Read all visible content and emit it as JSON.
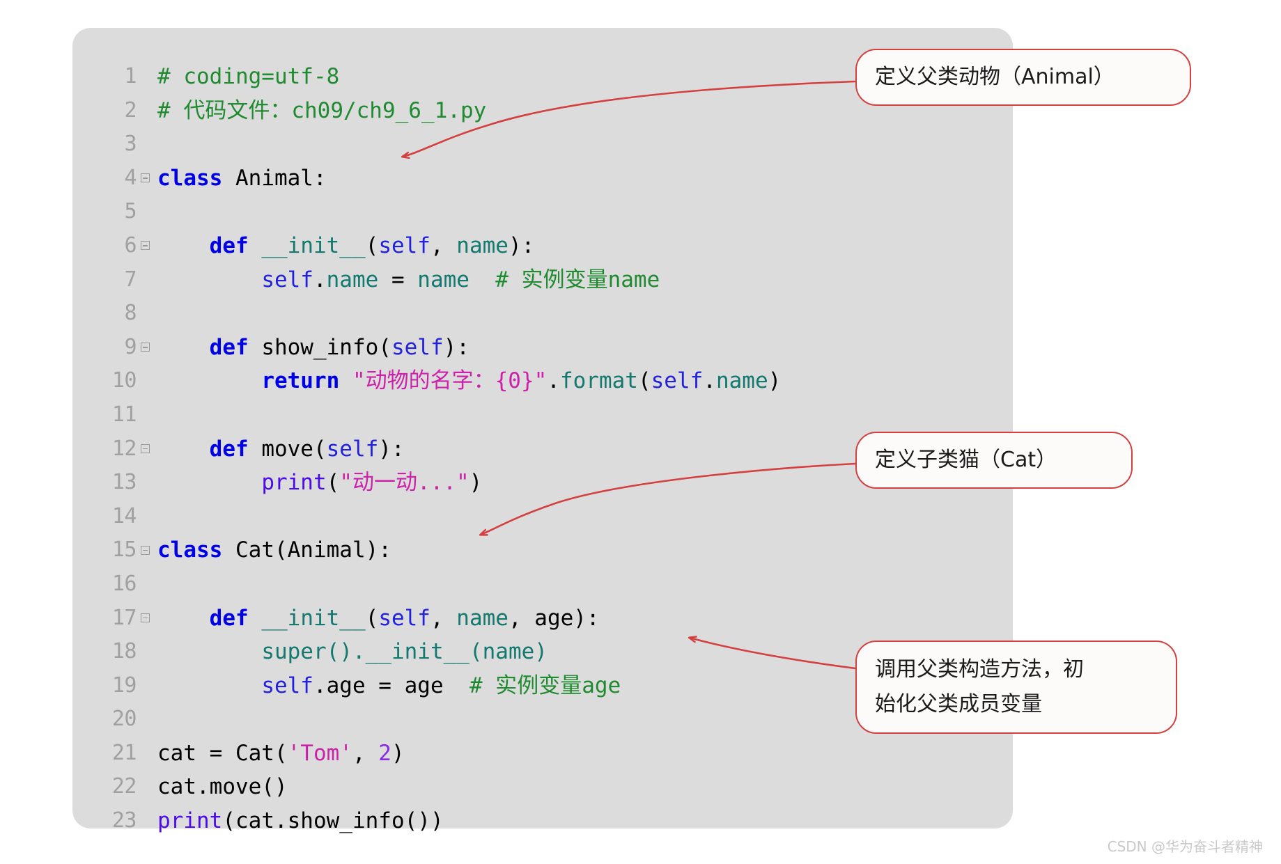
{
  "editor": {
    "panel_background": "#dcdcdc",
    "lines": [
      {
        "num": "1",
        "fold": false,
        "tokens": [
          {
            "t": "# coding=utf-8",
            "c": "cmt"
          }
        ]
      },
      {
        "num": "2",
        "fold": false,
        "tokens": [
          {
            "t": "# 代码文件：ch09/ch9_6_1.py",
            "c": "cmt"
          }
        ]
      },
      {
        "num": "3",
        "fold": false,
        "tokens": []
      },
      {
        "num": "4",
        "fold": true,
        "tokens": [
          {
            "t": "class",
            "c": "kw"
          },
          {
            "t": " Animal:",
            "c": "plain"
          }
        ]
      },
      {
        "num": "5",
        "fold": false,
        "tokens": []
      },
      {
        "num": "6",
        "fold": true,
        "tokens": [
          {
            "t": "    ",
            "c": "plain"
          },
          {
            "t": "def",
            "c": "kw"
          },
          {
            "t": " ",
            "c": "plain"
          },
          {
            "t": "__init__",
            "c": "teal"
          },
          {
            "t": "(",
            "c": "plain"
          },
          {
            "t": "self",
            "c": "self"
          },
          {
            "t": ", ",
            "c": "plain"
          },
          {
            "t": "name",
            "c": "teal"
          },
          {
            "t": "):",
            "c": "plain"
          }
        ]
      },
      {
        "num": "7",
        "fold": false,
        "tokens": [
          {
            "t": "        ",
            "c": "plain"
          },
          {
            "t": "self",
            "c": "self"
          },
          {
            "t": ".",
            "c": "plain"
          },
          {
            "t": "name",
            "c": "teal"
          },
          {
            "t": " = ",
            "c": "plain"
          },
          {
            "t": "name",
            "c": "teal"
          },
          {
            "t": "  ",
            "c": "plain"
          },
          {
            "t": "# 实例变量name",
            "c": "cmt"
          }
        ]
      },
      {
        "num": "8",
        "fold": false,
        "tokens": []
      },
      {
        "num": "9",
        "fold": true,
        "tokens": [
          {
            "t": "    ",
            "c": "plain"
          },
          {
            "t": "def",
            "c": "kw"
          },
          {
            "t": " show_info(",
            "c": "plain"
          },
          {
            "t": "self",
            "c": "self"
          },
          {
            "t": "):",
            "c": "plain"
          }
        ]
      },
      {
        "num": "10",
        "fold": false,
        "tokens": [
          {
            "t": "        ",
            "c": "plain"
          },
          {
            "t": "return",
            "c": "kw"
          },
          {
            "t": " ",
            "c": "plain"
          },
          {
            "t": "\"动物的名字：{0}\"",
            "c": "str"
          },
          {
            "t": ".",
            "c": "plain"
          },
          {
            "t": "format",
            "c": "teal"
          },
          {
            "t": "(",
            "c": "plain"
          },
          {
            "t": "self",
            "c": "self"
          },
          {
            "t": ".",
            "c": "plain"
          },
          {
            "t": "name",
            "c": "teal"
          },
          {
            "t": ")",
            "c": "plain"
          }
        ]
      },
      {
        "num": "11",
        "fold": false,
        "tokens": []
      },
      {
        "num": "12",
        "fold": true,
        "tokens": [
          {
            "t": "    ",
            "c": "plain"
          },
          {
            "t": "def",
            "c": "kw"
          },
          {
            "t": " move(",
            "c": "plain"
          },
          {
            "t": "self",
            "c": "self"
          },
          {
            "t": "):",
            "c": "plain"
          }
        ]
      },
      {
        "num": "13",
        "fold": false,
        "tokens": [
          {
            "t": "        ",
            "c": "plain"
          },
          {
            "t": "print",
            "c": "builtin"
          },
          {
            "t": "(",
            "c": "plain"
          },
          {
            "t": "\"动一动...\"",
            "c": "str"
          },
          {
            "t": ")",
            "c": "plain"
          }
        ]
      },
      {
        "num": "14",
        "fold": false,
        "tokens": []
      },
      {
        "num": "15",
        "fold": true,
        "tokens": [
          {
            "t": "class",
            "c": "kw"
          },
          {
            "t": " Cat(Animal):",
            "c": "plain"
          }
        ]
      },
      {
        "num": "16",
        "fold": false,
        "tokens": []
      },
      {
        "num": "17",
        "fold": true,
        "tokens": [
          {
            "t": "    ",
            "c": "plain"
          },
          {
            "t": "def",
            "c": "kw"
          },
          {
            "t": " ",
            "c": "plain"
          },
          {
            "t": "__init__",
            "c": "teal"
          },
          {
            "t": "(",
            "c": "plain"
          },
          {
            "t": "self",
            "c": "self"
          },
          {
            "t": ", ",
            "c": "plain"
          },
          {
            "t": "name",
            "c": "teal"
          },
          {
            "t": ", age):",
            "c": "plain"
          }
        ]
      },
      {
        "num": "18",
        "fold": false,
        "tokens": [
          {
            "t": "        ",
            "c": "plain"
          },
          {
            "t": "super",
            "c": "teal"
          },
          {
            "t": "().",
            "c": "teal"
          },
          {
            "t": "__init__",
            "c": "teal"
          },
          {
            "t": "(",
            "c": "teal"
          },
          {
            "t": "name",
            "c": "teal"
          },
          {
            "t": ")",
            "c": "teal"
          }
        ]
      },
      {
        "num": "19",
        "fold": false,
        "tokens": [
          {
            "t": "        ",
            "c": "plain"
          },
          {
            "t": "self",
            "c": "self"
          },
          {
            "t": ".age = age",
            "c": "plain"
          },
          {
            "t": "  ",
            "c": "plain"
          },
          {
            "t": "# 实例变量age",
            "c": "cmt"
          }
        ]
      },
      {
        "num": "20",
        "fold": false,
        "tokens": []
      },
      {
        "num": "21",
        "fold": false,
        "tokens": [
          {
            "t": "cat = Cat(",
            "c": "plain"
          },
          {
            "t": "'Tom'",
            "c": "str"
          },
          {
            "t": ", ",
            "c": "plain"
          },
          {
            "t": "2",
            "c": "num"
          },
          {
            "t": ")",
            "c": "plain"
          }
        ]
      },
      {
        "num": "22",
        "fold": false,
        "tokens": [
          {
            "t": "cat.move()",
            "c": "plain"
          }
        ]
      },
      {
        "num": "23",
        "fold": false,
        "tokens": [
          {
            "t": "print",
            "c": "builtin"
          },
          {
            "t": "(cat.show_info())",
            "c": "plain"
          }
        ]
      }
    ]
  },
  "annotations": [
    {
      "id": "callout-1",
      "text": "定义父类动物（Animal）",
      "target_line": "4",
      "color": "#d43f3f"
    },
    {
      "id": "callout-2",
      "text": "定义子类猫（Cat）",
      "target_line": "15",
      "color": "#d43f3f"
    },
    {
      "id": "callout-3",
      "text": "调用父类构造方法，初\n始化父类成员变量",
      "target_line": "18",
      "color": "#d43f3f"
    }
  ],
  "watermark": {
    "text": "CSDN @华为奋斗者精神"
  }
}
